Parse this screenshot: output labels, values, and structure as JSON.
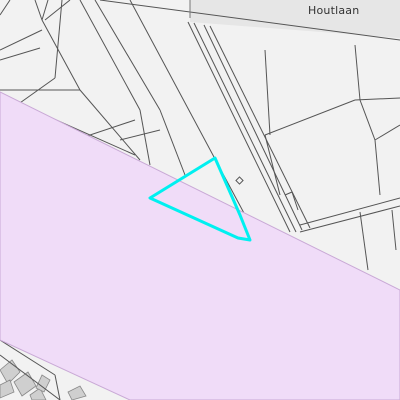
{
  "map": {
    "street_label": "Houtlaan",
    "colors": {
      "background": "#f2f2f2",
      "parcel_line": "#555555",
      "road_fill": "#e4e4e4",
      "zone_fill": "#f0dcf8",
      "zone_outline": "#c9a9d6",
      "selection_outline": "#00f0f0",
      "building_fill": "#cfcfcf"
    },
    "icons": [
      "parcel-marker-icon"
    ]
  }
}
